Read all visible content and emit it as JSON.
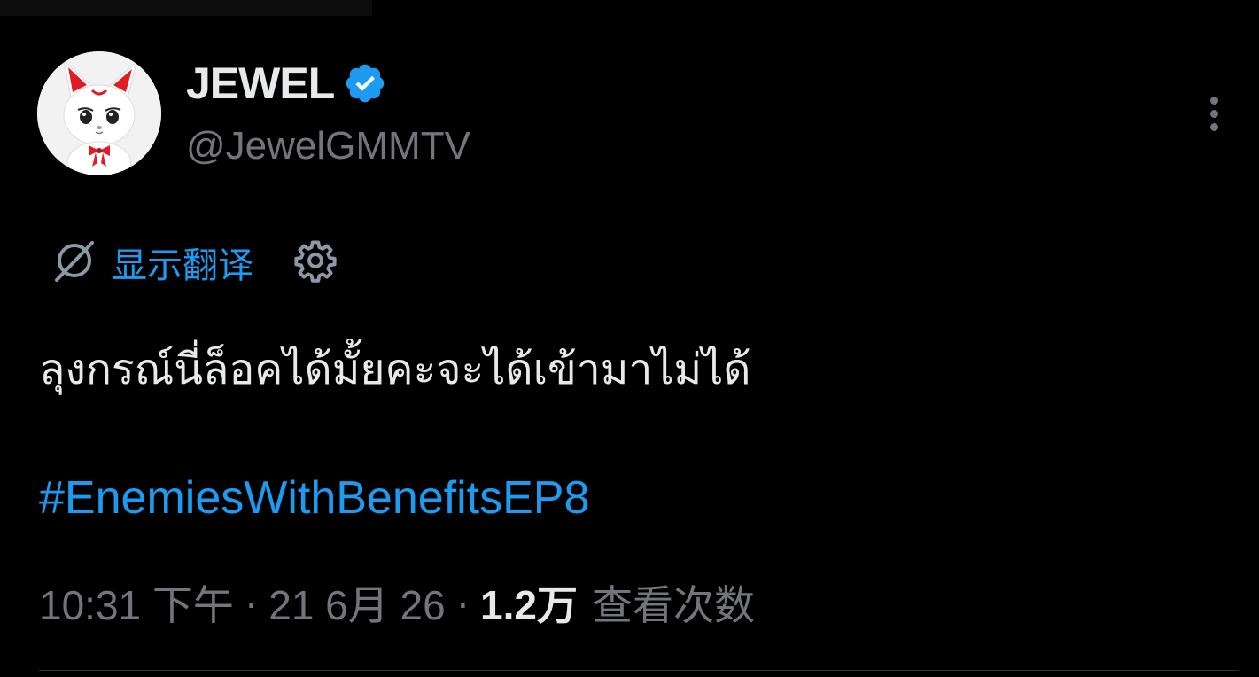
{
  "author": {
    "display_name": "JEWEL",
    "handle": "@JewelGMMTV",
    "verified": true,
    "avatar_icon": "white-fox-mascot-avatar",
    "verified_icon": "verified-badge-icon"
  },
  "translate": {
    "label": "显示翻译",
    "translate_icon": "translate-off-icon",
    "settings_icon": "gear-icon"
  },
  "tweet": {
    "text": "ลุงกรณ์นี่ล็อคได้มั้ยคะจะได้เข้ามาไม่ได้",
    "hashtag": "#EnemiesWithBenefitsEP8"
  },
  "meta": {
    "time": "10:31 下午",
    "separator": "·",
    "date": "21 6月 26",
    "views_count": "1.2万",
    "views_label": "查看次数"
  },
  "menu": {
    "more_icon": "more-vertical-icon"
  },
  "colors": {
    "background": "#000000",
    "text_primary": "#e7e9ea",
    "text_secondary": "#71767b",
    "accent": "#1d9bf0"
  }
}
